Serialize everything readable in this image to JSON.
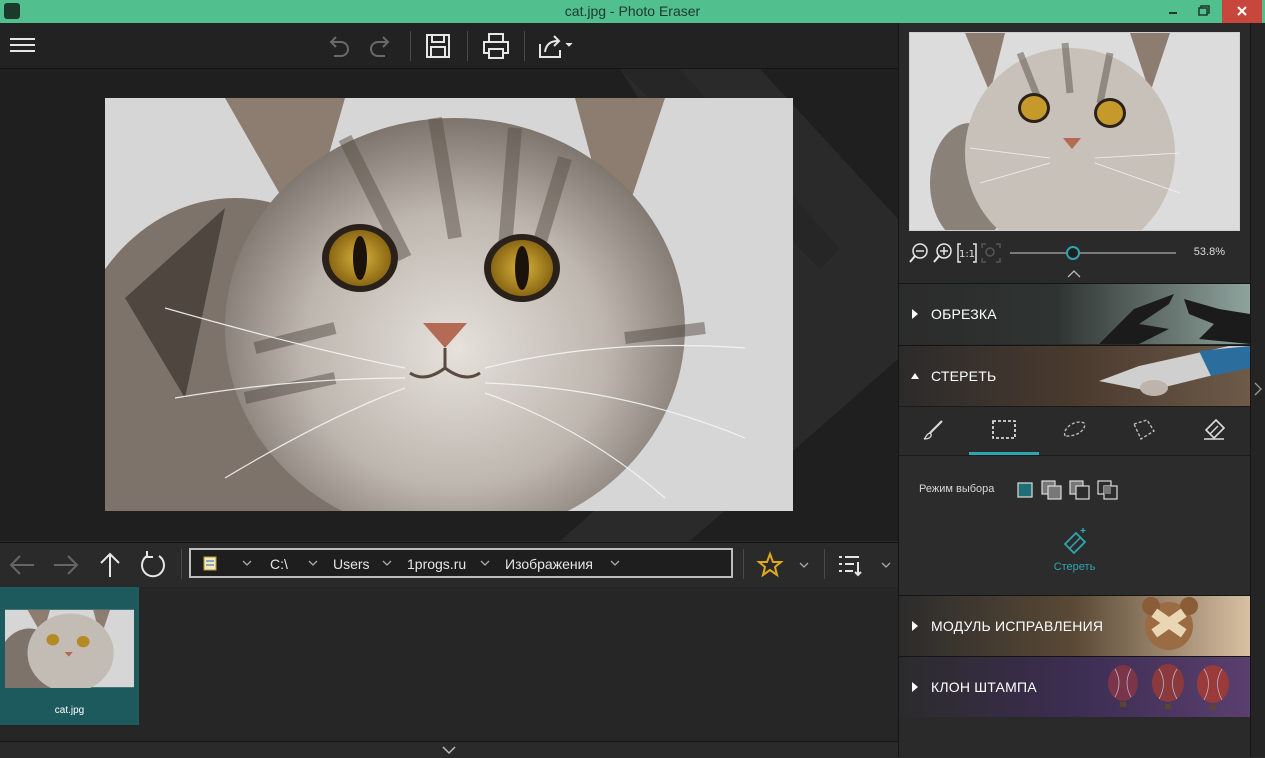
{
  "window": {
    "title": "cat.jpg - Photo Eraser"
  },
  "preview": {
    "zoom": "53.8%",
    "zoom_fraction": 0.38
  },
  "sections": {
    "crop": "ОБРЕЗКА",
    "erase": "СТЕРЕТЬ",
    "fix": "МОДУЛЬ ИСПРАВЛЕНИЯ",
    "clone": "КЛОН ШТАМПА"
  },
  "erase_panel": {
    "mode_label": "Режим выбора",
    "erase_button": "Стереть"
  },
  "path": {
    "segments": [
      "C:\\",
      "Users",
      "1progs.ru",
      "Изображения"
    ]
  },
  "files": [
    {
      "name": "cat.jpg"
    }
  ],
  "colors": {
    "accent": "#2ea6b0",
    "titlebar": "#52bf8f"
  }
}
